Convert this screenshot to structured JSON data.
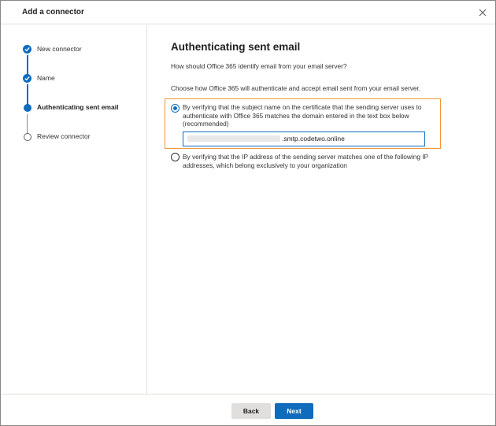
{
  "dialog": {
    "title": "Add a connector",
    "close_icon": "close-icon"
  },
  "wizard": {
    "steps": [
      {
        "label": "New connector",
        "status": "completed"
      },
      {
        "label": "Name",
        "status": "completed"
      },
      {
        "label": "Authenticating sent email",
        "status": "current"
      },
      {
        "label": "Review connector",
        "status": "pending"
      }
    ]
  },
  "main": {
    "heading": "Authenticating sent email",
    "question": "How should Office 365 identify email from your email server?",
    "instruction": "Choose how Office 365 will authenticate and accept email sent from your email server.",
    "options": [
      {
        "text": "By verifying that the subject name on the certificate that the sending server uses to authenticate with Office 365 matches the domain entered in the text box below (recommended)",
        "selected": true
      },
      {
        "text": "By verifying that the IP address of the sending server matches one of the following IP addresses, which belong exclusively to your organization",
        "selected": false
      }
    ],
    "domain_field": {
      "visible_suffix": ".smtp.codetwo.online"
    }
  },
  "footer": {
    "back_label": "Back",
    "next_label": "Next"
  },
  "colors": {
    "accent": "#0f6cbd",
    "highlight": "#f0953a"
  }
}
